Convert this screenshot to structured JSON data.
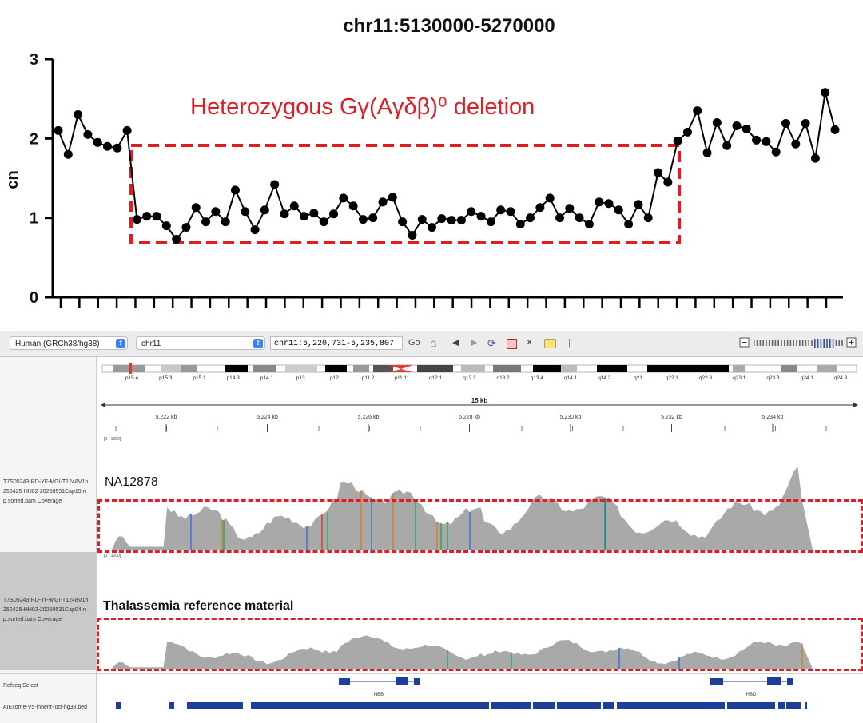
{
  "chart_data": {
    "type": "line",
    "title": "chr11:5130000-5270000",
    "xlabel": "",
    "ylabel": "cn",
    "ylim": [
      0,
      3
    ],
    "yticks": [
      "0",
      "1",
      "2",
      "3"
    ],
    "x_tick_count": 42,
    "series": [
      {
        "values": [
          2.1,
          1.8,
          2.3,
          2.05,
          1.95,
          1.9,
          1.88,
          2.1,
          0.98,
          1.02,
          1.02,
          0.9,
          0.73,
          0.88,
          1.13,
          0.95,
          1.08,
          0.95,
          1.35,
          1.08,
          0.85,
          1.1,
          1.42,
          1.05,
          1.15,
          1.02,
          1.06,
          0.95,
          1.05,
          1.25,
          1.15,
          0.98,
          1.0,
          1.2,
          1.26,
          0.95,
          0.78,
          0.98,
          0.88,
          0.99,
          0.97,
          0.97,
          1.08,
          1.02,
          0.95,
          1.1,
          1.08,
          0.92,
          1.0,
          1.13,
          1.25,
          1.0,
          1.12,
          1.0,
          0.92,
          1.2,
          1.18,
          1.1,
          0.92,
          1.17,
          1.0,
          1.57,
          1.45,
          1.97,
          2.08,
          2.35,
          1.82,
          2.2,
          1.91,
          2.16,
          2.12,
          1.98,
          1.96,
          1.83,
          2.19,
          1.93,
          2.19,
          1.75,
          2.58,
          2.11
        ]
      }
    ],
    "annotation": "Heterozygous Gγ(Aγδβ)⁰  deletion",
    "colors": {
      "line": "#000000",
      "annotation": "#e11d24"
    }
  },
  "igv": {
    "genome_select": "Human (GRCh38/hg38)",
    "chrom_select": "chr11",
    "locus": "chr11:5,220,731-5,235,807",
    "go_label": "Go",
    "toolbar_icons": [
      "home-icon",
      "back-icon",
      "forward-icon",
      "refresh-icon",
      "roi-icon",
      "close-icon",
      "popup-icon"
    ],
    "ideogram_bands": [
      "p15.4",
      "p15.3",
      "p15.1",
      "p14.3",
      "p14.1",
      "p13",
      "p12",
      "p11.2",
      "p11.11",
      "q12.1",
      "q12.3",
      "q13.2",
      "q13.4",
      "q14.1",
      "q14.2",
      "q21",
      "q22.1",
      "q22.3",
      "q23.1",
      "q23.3",
      "q24.1",
      "q24.3"
    ],
    "ruler_span": "15 kb",
    "ruler_ticks": [
      "5,222 kb",
      "5,224 kb",
      "5,226 kb",
      "5,228 kb",
      "5,230 kb",
      "5,232 kb",
      "5,234 kb"
    ],
    "tracks": [
      {
        "name": "T7S05243-RD-YF-MGI-T1248V1h 250425-HH02-20250531Cap19.n p.sorted.bam Coverage",
        "range": "[0 - 1200]",
        "annotation": "NA12878"
      },
      {
        "name": "T7S05243-RD-YF-MGI-T1248V1h 250425-HH02-20250531Cap04.n p.sorted.bam Coverage",
        "range": "[0 - 1200]",
        "annotation": "Thalassemia reference material"
      }
    ],
    "refseq_label": "Refseq Select",
    "genes": [
      "HBB",
      "HBD"
    ],
    "bed_label": "AIExome-V5-inherit-loci-hg38.bed"
  }
}
